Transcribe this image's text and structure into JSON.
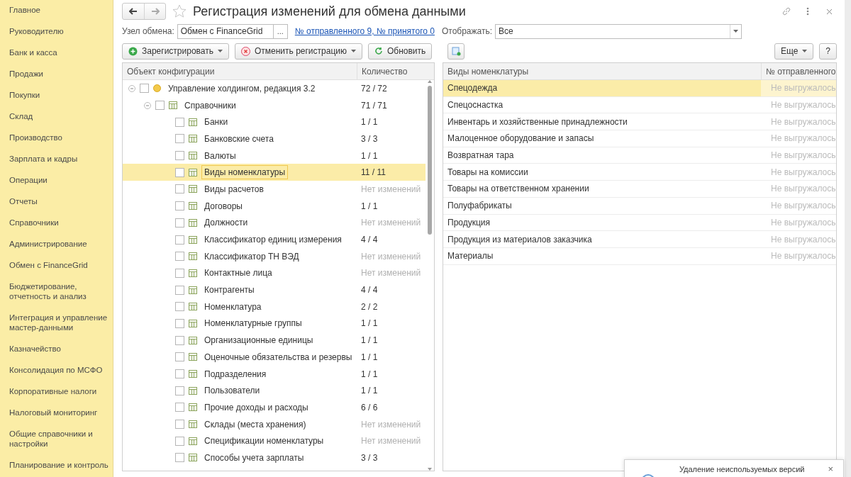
{
  "sidebar": {
    "items": [
      {
        "label": "Главное"
      },
      {
        "label": "Руководителю"
      },
      {
        "label": "Банк и касса"
      },
      {
        "label": "Продажи"
      },
      {
        "label": "Покупки"
      },
      {
        "label": "Склад"
      },
      {
        "label": "Производство"
      },
      {
        "label": "Зарплата и кадры"
      },
      {
        "label": "Операции"
      },
      {
        "label": "Отчеты"
      },
      {
        "label": "Справочники"
      },
      {
        "label": "Администрирование"
      },
      {
        "label": "Обмен с FinanceGrid"
      },
      {
        "label": "Бюджетирование, отчетность и анализ"
      },
      {
        "label": "Интеграция и управление мастер-данными"
      },
      {
        "label": "Казначейство"
      },
      {
        "label": "Консолидация по МСФО"
      },
      {
        "label": "Корпоративные налоги"
      },
      {
        "label": "Налоговый мониторинг"
      },
      {
        "label": "Общие справочники и настройки"
      },
      {
        "label": "Планирование и контроль"
      }
    ]
  },
  "window": {
    "title": "Регистрация изменений для обмена данными"
  },
  "filters": {
    "node_label": "Узел обмена:",
    "node_value": "Обмен с FinanceGrid",
    "node_button": "...",
    "link": "№ отправленного 9, № принятого 0",
    "show_label": "Отображать:",
    "show_value": "Все"
  },
  "toolbar": {
    "register": "Зарегистрировать",
    "cancel": "Отменить регистрацию",
    "refresh": "Обновить",
    "more": "Еще",
    "help": "?"
  },
  "tree": {
    "columns": [
      "Объект конфигурации",
      "Количество"
    ],
    "items": [
      {
        "kind": "config",
        "name": "Управление холдингом, редакция 3.2",
        "count": "72 / 72",
        "changed": true,
        "checked": false,
        "selected": false,
        "expanded": true,
        "children": [
          {
            "kind": "catalog",
            "name": "Справочники",
            "count": "71 / 71",
            "changed": true,
            "checked": false,
            "selected": false,
            "expanded": true,
            "children": [
              {
                "kind": "catalog",
                "name": "Банки",
                "count": "1 / 1",
                "changed": true,
                "checked": false,
                "selected": false
              },
              {
                "kind": "catalog",
                "name": "Банковские счета",
                "count": "3 / 3",
                "changed": true,
                "checked": false,
                "selected": false
              },
              {
                "kind": "catalog",
                "name": "Валюты",
                "count": "1 / 1",
                "changed": true,
                "checked": false,
                "selected": false
              },
              {
                "kind": "catalog",
                "name": "Виды номенклатуры",
                "count": "11 / 11",
                "changed": true,
                "checked": false,
                "selected": true
              },
              {
                "kind": "catalog",
                "name": "Виды расчетов",
                "count": "Нет изменений",
                "changed": false,
                "checked": false,
                "selected": false
              },
              {
                "kind": "catalog",
                "name": "Договоры",
                "count": "1 / 1",
                "changed": true,
                "checked": false,
                "selected": false
              },
              {
                "kind": "catalog",
                "name": "Должности",
                "count": "Нет изменений",
                "changed": false,
                "checked": false,
                "selected": false
              },
              {
                "kind": "catalog",
                "name": "Классификатор единиц измерения",
                "count": "4 / 4",
                "changed": true,
                "checked": false,
                "selected": false
              },
              {
                "kind": "catalog",
                "name": "Классификатор ТН ВЭД",
                "count": "Нет изменений",
                "changed": false,
                "checked": false,
                "selected": false
              },
              {
                "kind": "catalog",
                "name": "Контактные лица",
                "count": "Нет изменений",
                "changed": false,
                "checked": false,
                "selected": false
              },
              {
                "kind": "catalog",
                "name": "Контрагенты",
                "count": "4 / 4",
                "changed": true,
                "checked": false,
                "selected": false
              },
              {
                "kind": "catalog",
                "name": "Номенклатура",
                "count": "2 / 2",
                "changed": true,
                "checked": false,
                "selected": false
              },
              {
                "kind": "catalog",
                "name": "Номенклатурные группы",
                "count": "1 / 1",
                "changed": true,
                "checked": false,
                "selected": false
              },
              {
                "kind": "catalog",
                "name": "Организационные единицы",
                "count": "1 / 1",
                "changed": true,
                "checked": false,
                "selected": false
              },
              {
                "kind": "catalog",
                "name": "Оценочные обязательства и резервы",
                "count": "1 / 1",
                "changed": true,
                "checked": false,
                "selected": false
              },
              {
                "kind": "catalog",
                "name": "Подразделения",
                "count": "1 / 1",
                "changed": true,
                "checked": false,
                "selected": false
              },
              {
                "kind": "catalog",
                "name": "Пользователи",
                "count": "1 / 1",
                "changed": true,
                "checked": false,
                "selected": false
              },
              {
                "kind": "catalog",
                "name": "Прочие доходы и расходы",
                "count": "6 / 6",
                "changed": true,
                "checked": false,
                "selected": false
              },
              {
                "kind": "catalog",
                "name": "Склады (места хранения)",
                "count": "Нет изменений",
                "changed": false,
                "checked": false,
                "selected": false
              },
              {
                "kind": "catalog",
                "name": "Спецификации номенклатуры",
                "count": "Нет изменений",
                "changed": false,
                "checked": false,
                "selected": false
              },
              {
                "kind": "catalog",
                "name": "Способы учета зарплаты",
                "count": "3 / 3",
                "changed": true,
                "checked": false,
                "selected": false
              }
            ]
          }
        ]
      }
    ]
  },
  "list": {
    "columns": [
      "Виды номенклатуры",
      "№ отправленного"
    ],
    "rows": [
      {
        "name": "Спецодежда",
        "status": "Не выгружалось",
        "selected": true
      },
      {
        "name": "Спецоснастка",
        "status": "Не выгружалось",
        "selected": false
      },
      {
        "name": "Инвентарь и хозяйственные принадлежности",
        "status": "Не выгружалось",
        "selected": false
      },
      {
        "name": "Малоценное оборудование и запасы",
        "status": "Не выгружалось",
        "selected": false
      },
      {
        "name": "Возвратная тара",
        "status": "Не выгружалось",
        "selected": false
      },
      {
        "name": "Товары на комиссии",
        "status": "Не выгружалось",
        "selected": false
      },
      {
        "name": "Товары на ответственном хранении",
        "status": "Не выгружалось",
        "selected": false
      },
      {
        "name": "Полуфабрикаты",
        "status": "Не выгружалось",
        "selected": false
      },
      {
        "name": "Продукция",
        "status": "Не выгружалось",
        "selected": false
      },
      {
        "name": "Продукция из материалов заказчика",
        "status": "Не выгружалось",
        "selected": false
      },
      {
        "name": "Материалы",
        "status": "Не выгружалось",
        "selected": false
      }
    ]
  },
  "notification": {
    "text": "Удаление неиспользуемых версий",
    "close": "×"
  }
}
